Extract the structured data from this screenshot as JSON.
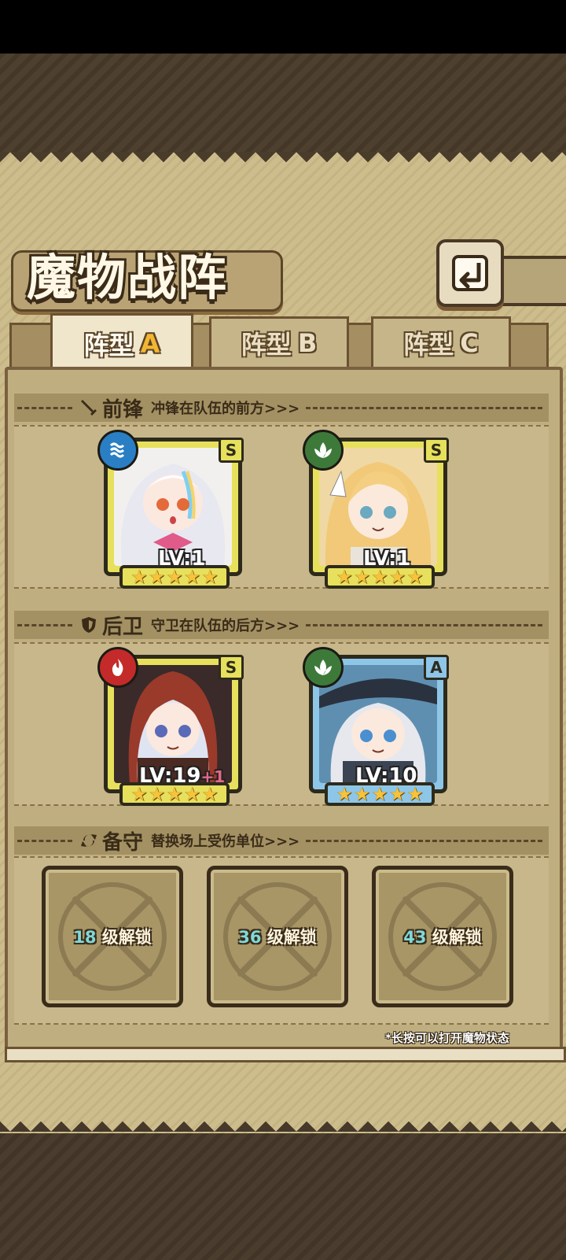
{
  "title": "魔物战阵",
  "tabs": [
    {
      "label": "阵型",
      "letter": "A",
      "active": true
    },
    {
      "label": "阵型",
      "letter": "B",
      "active": false
    },
    {
      "label": "阵型",
      "letter": "C",
      "active": false
    }
  ],
  "sections": {
    "front": {
      "title": "前锋",
      "subtitle": "冲锋在队伍的前方>>>",
      "icon": "sword-icon"
    },
    "back": {
      "title": "后卫",
      "subtitle": "守卫在队伍的后方>>>",
      "icon": "shield-icon"
    },
    "reserve": {
      "title": "备守",
      "subtitle": "替换场上受伤单位>>>",
      "icon": "swap-icon"
    }
  },
  "units": [
    {
      "level": "LV:1",
      "bonus": "",
      "rank": "S",
      "element": "water",
      "stars": 5
    },
    {
      "level": "LV:1",
      "bonus": "",
      "rank": "S",
      "element": "nature",
      "stars": 5
    },
    {
      "level": "LV:19",
      "bonus": "+1",
      "rank": "S",
      "element": "fire",
      "stars": 5
    },
    {
      "level": "LV:10",
      "bonus": "",
      "rank": "A",
      "element": "nature",
      "stars": 5
    }
  ],
  "reserve_slots": [
    {
      "level": "18",
      "text": "级解锁"
    },
    {
      "level": "36",
      "text": "级解锁"
    },
    {
      "level": "43",
      "text": "级解锁"
    }
  ],
  "hint": "*长按可以打开魔物状态",
  "colors": {
    "water": "#2a7fc4",
    "nature": "#3d7a3a",
    "fire": "#c42a2a",
    "star": "#f6c33a",
    "accent": "#f2b632"
  }
}
